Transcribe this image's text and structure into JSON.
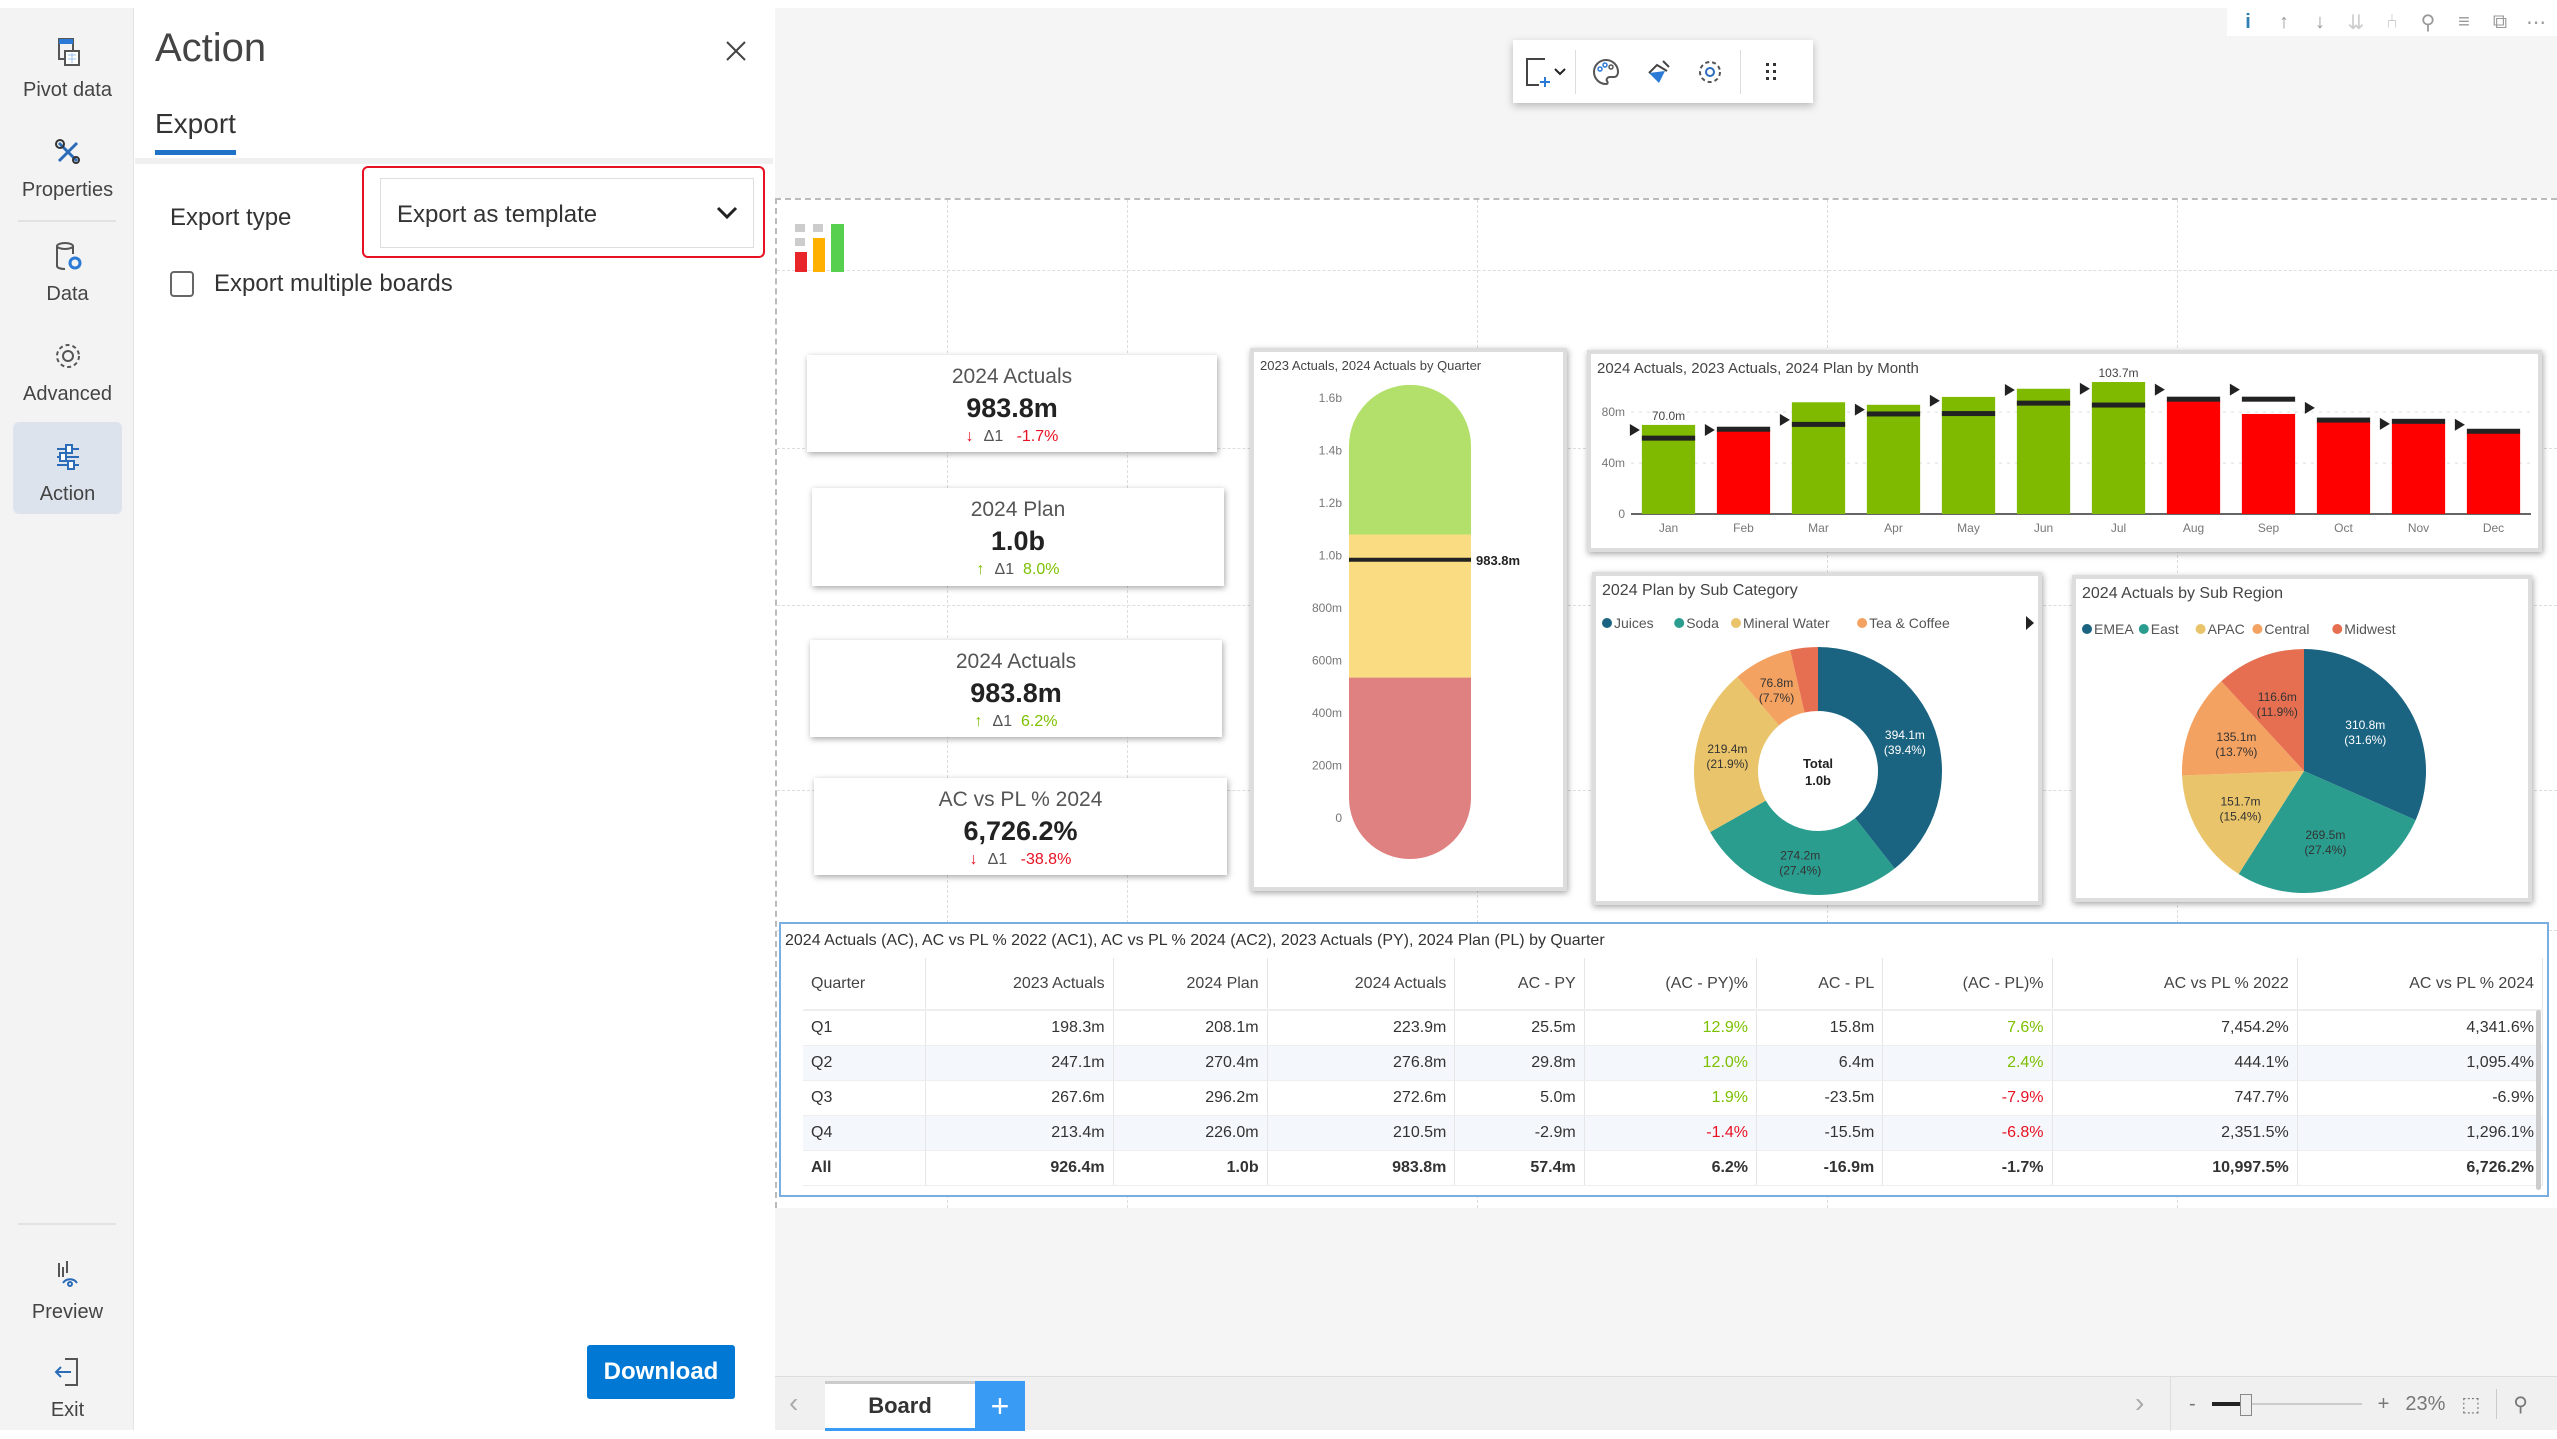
{
  "rail": {
    "items": [
      {
        "label": "Pivot data",
        "icon": "pivot-data-icon"
      },
      {
        "label": "Properties",
        "icon": "tools-icon"
      },
      {
        "label": "Data",
        "icon": "database-settings-icon"
      },
      {
        "label": "Advanced",
        "icon": "gear-icon"
      },
      {
        "label": "Action",
        "icon": "sliders-icon",
        "active": true
      }
    ],
    "bottom_items": [
      {
        "label": "Preview",
        "icon": "preview-icon"
      },
      {
        "label": "Exit",
        "icon": "exit-icon"
      }
    ]
  },
  "panel": {
    "title": "Action",
    "tab": "Export",
    "export_type_label": "Export type",
    "export_type_value": "Export as template",
    "checkbox_label": "Export multiple boards",
    "checkbox_checked": false,
    "download_label": "Download"
  },
  "toolbar": {
    "icons": [
      "add-visual-icon",
      "chevron-down-icon",
      "palette-icon",
      "paint-brush-icon",
      "gear-icon",
      "drag-handle-icon"
    ]
  },
  "top_icons": [
    "info-icon",
    "arrow-up-icon",
    "arrow-down-icon",
    "double-arrow-down-icon",
    "drill-icon",
    "pin-icon",
    "filter-icon",
    "expand-icon",
    "more-icon"
  ],
  "kpis": [
    {
      "title": "2024 Actuals",
      "value": "983.8m",
      "direction": "down",
      "delta_label": "Δ1",
      "delta": "-1.7%"
    },
    {
      "title": "2024 Plan",
      "value": "1.0b",
      "direction": "up",
      "delta_label": "Δ1",
      "delta": "8.0%"
    },
    {
      "title": "2024 Actuals",
      "value": "983.8m",
      "direction": "up",
      "delta_label": "Δ1",
      "delta": "6.2%"
    },
    {
      "title": "AC vs PL % 2024",
      "value": "6,726.2%",
      "direction": "down",
      "delta_label": "Δ1",
      "delta": "-38.8%"
    }
  ],
  "colors": {
    "positive": "#7cc000",
    "negative": "#e81123",
    "accent": "#0078d4",
    "bar_good": "#7fba00",
    "bar_bad": "#ff0000"
  },
  "chart_data": [
    {
      "type": "gauge",
      "title": "2023 Actuals,  2024 Actuals  by  Quarter",
      "ytick_labels": [
        "0",
        "200m",
        "400m",
        "600m",
        "800m",
        "1.0b",
        "1.2b",
        "1.4b",
        "1.6b"
      ],
      "ylim": [
        0,
        1600
      ],
      "bands": [
        {
          "from": 0,
          "to": 535,
          "color": "#df8180"
        },
        {
          "from": 535,
          "to": 1080,
          "color": "#fadc82"
        },
        {
          "from": 1080,
          "to": 1650,
          "color": "#b3e06b"
        }
      ],
      "marker_value": 983.8,
      "marker_label": "983.8m"
    },
    {
      "type": "bar",
      "title": "2024 Actuals, 2023 Actuals, 2024 Plan by Month",
      "categories": [
        "Jan",
        "Feb",
        "Mar",
        "Apr",
        "May",
        "Jun",
        "Jul",
        "Aug",
        "Sep",
        "Oct",
        "Nov",
        "Dec"
      ],
      "series": [
        {
          "name": "2024 Actuals",
          "values": [
            70.0,
            65.7,
            87.8,
            85.8,
            92.0,
            98.4,
            103.7,
            89.2,
            78.6,
            72.2,
            71.1,
            63.7
          ]
        },
        {
          "name": "2024 Plan",
          "values": [
            60.0,
            67.0,
            70.8,
            79.0,
            79.3,
            87.5,
            86.0,
            90.6,
            90.6,
            74.2,
            73.2,
            65.4
          ]
        },
        {
          "name": "2023 Actuals",
          "values": [
            66.0,
            66.0,
            74.0,
            82.0,
            89.0,
            97.4,
            98.4,
            97.7,
            97.7,
            83.4,
            70.8,
            70.1
          ]
        }
      ],
      "data_labels": [
        {
          "category": "Jan",
          "text": "70.0m"
        },
        {
          "category": "Jul",
          "text": "103.7m"
        }
      ],
      "ytick_labels": [
        "0",
        "40m",
        "80m"
      ],
      "ylim": [
        0,
        110
      ],
      "grid": true
    },
    {
      "type": "pie",
      "variant": "donut",
      "title": "2024 Plan by Sub Category",
      "center_label": [
        "Total",
        "1.0b"
      ],
      "legend": [
        "Juices",
        "Soda",
        "Mineral Water",
        "Tea & Coffee"
      ],
      "legend_position": "top",
      "slices": [
        {
          "name": "Juices",
          "value": 394.1,
          "label": "394.1m",
          "pct": "(39.4%)",
          "color": "#1a6381"
        },
        {
          "name": "Soda",
          "value": 274.2,
          "label": "274.2m",
          "pct": "(27.4%)",
          "color": "#2a9d8f"
        },
        {
          "name": "Mineral Water",
          "value": 219.4,
          "label": "219.4m",
          "pct": "(21.9%)",
          "color": "#e9c46a"
        },
        {
          "name": "Tea & Coffee",
          "value": 76.8,
          "label": "76.8m",
          "pct": "(7.7%)",
          "color": "#f4a261"
        },
        {
          "name": "Other",
          "value": 36.0,
          "label": "",
          "pct": "",
          "color": "#e76f51"
        }
      ]
    },
    {
      "type": "pie",
      "title": "2024 Actuals by Sub Region",
      "legend": [
        "EMEA",
        "East",
        "APAC",
        "Central",
        "Midwest"
      ],
      "legend_position": "top",
      "slices": [
        {
          "name": "EMEA",
          "value": 310.8,
          "label": "310.8m",
          "pct": "(31.6%)",
          "color": "#1a6381"
        },
        {
          "name": "East",
          "value": 269.5,
          "label": "269.5m",
          "pct": "(27.4%)",
          "color": "#2a9d8f"
        },
        {
          "name": "APAC",
          "value": 151.7,
          "label": "151.7m",
          "pct": "(15.4%)",
          "color": "#e9c46a"
        },
        {
          "name": "Central",
          "value": 135.1,
          "label": "135.1m",
          "pct": "(13.7%)",
          "color": "#f4a261"
        },
        {
          "name": "Midwest",
          "value": 116.6,
          "label": "116.6m",
          "pct": "(11.9%)",
          "color": "#e76f51"
        }
      ]
    },
    {
      "type": "table",
      "title": "2024 Actuals (AC), AC vs PL % 2022 (AC1), AC vs PL % 2024 (AC2), 2023 Actuals (PY), 2024 Plan (PL) by Quarter",
      "columns": [
        "Quarter",
        "2023 Actuals",
        "2024 Plan",
        "2024 Actuals",
        "AC - PY",
        "(AC - PY)%",
        "AC - PL",
        "(AC - PL)%",
        "AC vs PL % 2022",
        "AC vs PL % 2024"
      ],
      "rows": [
        [
          "Q1",
          "198.3m",
          "208.1m",
          "223.9m",
          "25.5m",
          "12.9%",
          "15.8m",
          "7.6%",
          "7,454.2%",
          "4,341.6%"
        ],
        [
          "Q2",
          "247.1m",
          "270.4m",
          "276.8m",
          "29.8m",
          "12.0%",
          "6.4m",
          "2.4%",
          "444.1%",
          "1,095.4%"
        ],
        [
          "Q3",
          "267.6m",
          "296.2m",
          "272.6m",
          "5.0m",
          "1.9%",
          "-23.5m",
          "-7.9%",
          "747.7%",
          "-6.9%"
        ],
        [
          "Q4",
          "213.4m",
          "226.0m",
          "210.5m",
          "-2.9m",
          "-1.4%",
          "-15.5m",
          "-6.8%",
          "2,351.5%",
          "1,296.1%"
        ],
        [
          "All",
          "926.4m",
          "1.0b",
          "983.8m",
          "57.4m",
          "6.2%",
          "-16.9m",
          "-1.7%",
          "10,997.5%",
          "6,726.2%"
        ]
      ]
    }
  ],
  "bottom": {
    "board_tab": "Board",
    "add_tab": "+",
    "zoom_minus": "-",
    "zoom_plus": "+",
    "zoom_level": "23%",
    "zoom_fraction": 0.23
  }
}
